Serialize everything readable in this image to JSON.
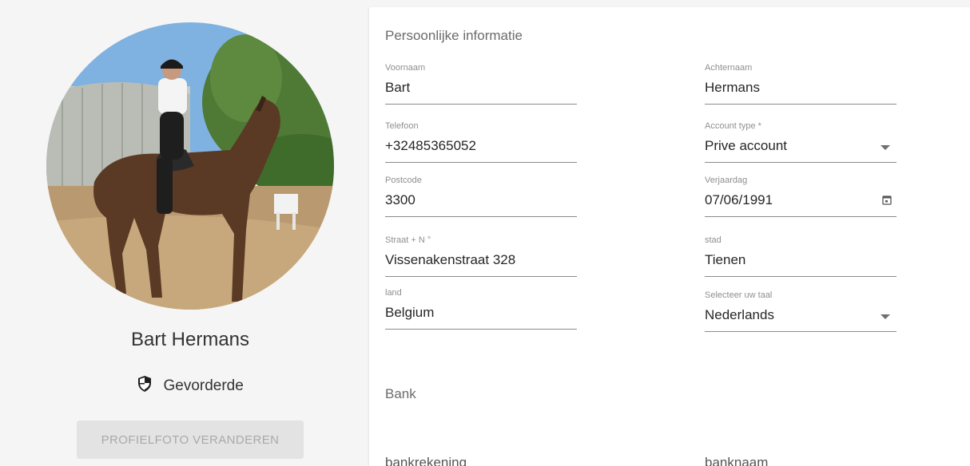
{
  "profile": {
    "name": "Bart Hermans",
    "role": "Gevorderde",
    "change_photo_label": "PROFIELFOTO VERANDEREN"
  },
  "personal": {
    "title": "Persoonlijke informatie",
    "firstname": {
      "label": "Voornaam",
      "value": "Bart"
    },
    "lastname": {
      "label": "Achternaam",
      "value": "Hermans"
    },
    "phone": {
      "label": "Telefoon",
      "value": "+32485365052"
    },
    "account_type": {
      "label": "Account type *",
      "value": "Prive account"
    },
    "postcode": {
      "label": "Postcode",
      "value": "3300"
    },
    "birthday": {
      "label": "Verjaardag",
      "value": "07/06/1991"
    },
    "street": {
      "label": "Straat + N °",
      "value": "Vissenakenstraat 328"
    },
    "city": {
      "label": "stad",
      "value": "Tienen"
    },
    "country": {
      "label": "land",
      "value": "Belgium"
    },
    "language": {
      "label": "Selecteer uw taal",
      "value": "Nederlands"
    }
  },
  "bank": {
    "title": "Bank",
    "account_label": "bankrekening",
    "name_label": "banknaam"
  },
  "icons": {
    "role": "shield-icon",
    "calendar": "calendar-icon",
    "dropdown": "chevron-down-icon"
  }
}
